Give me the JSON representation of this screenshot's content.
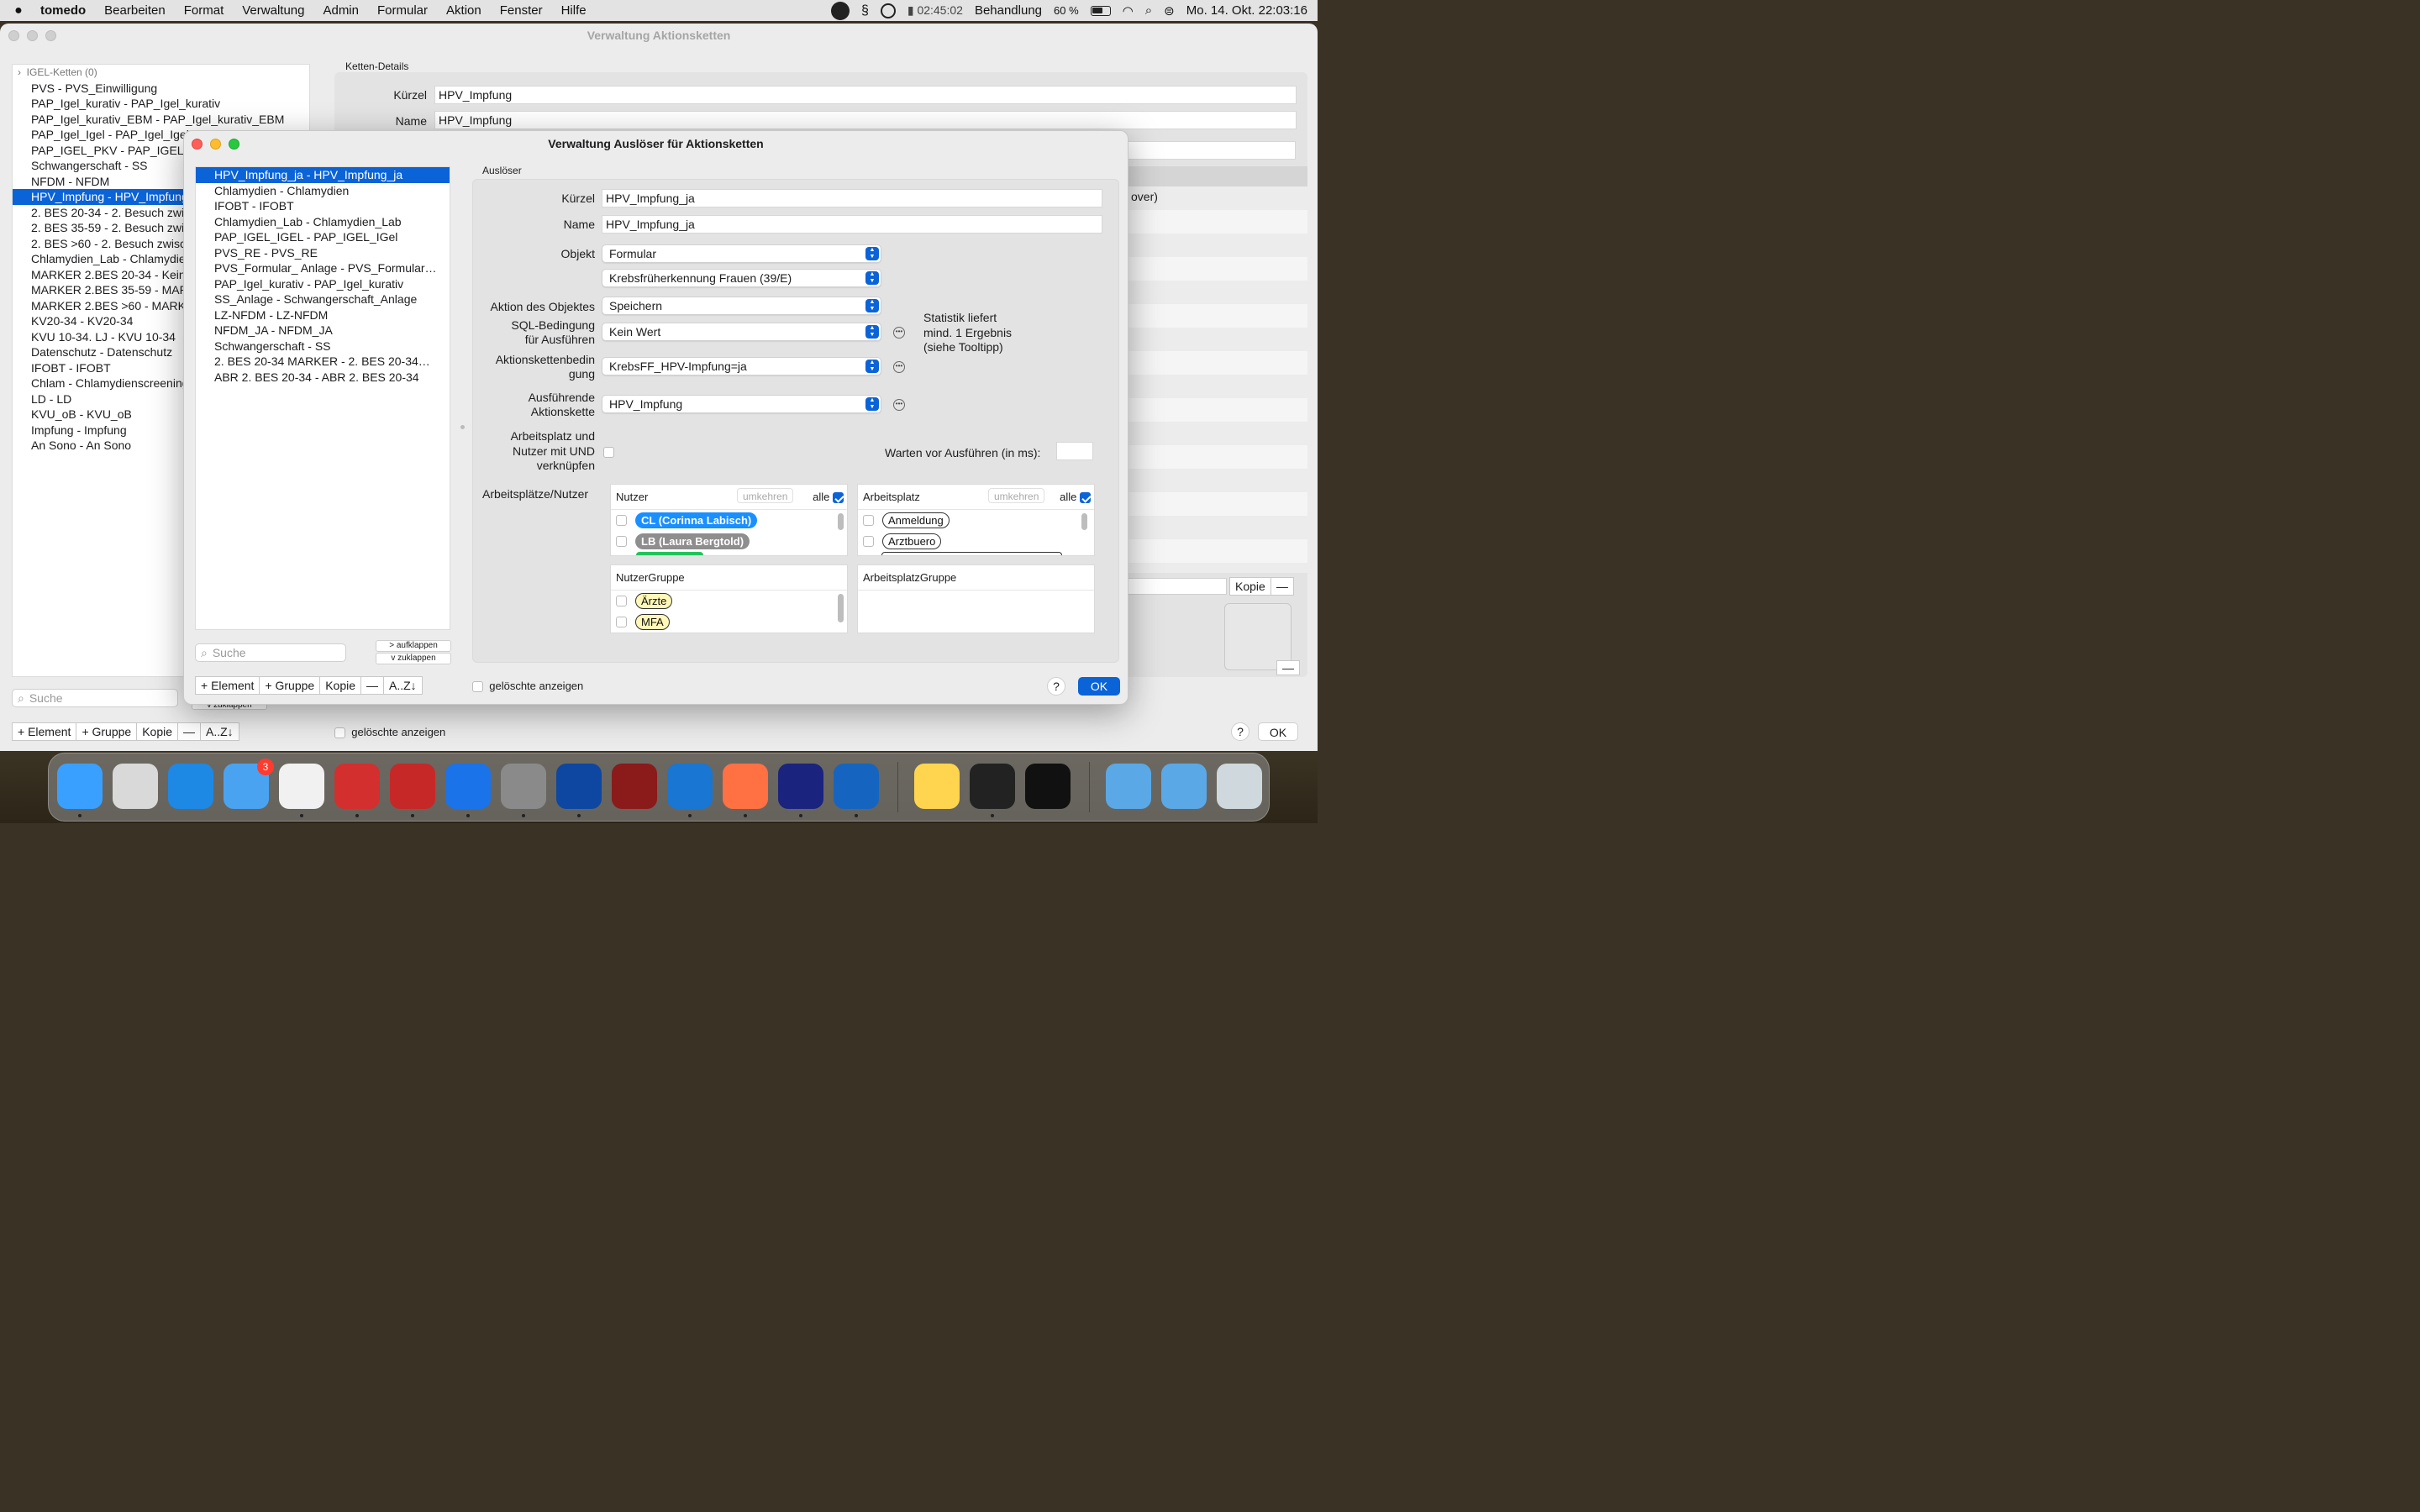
{
  "menubar": {
    "app": "tomedo",
    "items": [
      "Bearbeiten",
      "Format",
      "Verwaltung",
      "Admin",
      "Formular",
      "Aktion",
      "Fenster",
      "Hilfe"
    ],
    "timer": "02:45:02",
    "status": "Behandlung",
    "battery": "60 %",
    "clock": "Mo. 14. Okt. 22:03:16"
  },
  "main_window": {
    "title": "Verwaltung Aktionsketten",
    "list": {
      "group_header": "IGEL-Ketten (0)",
      "items": [
        "PVS - PVS_Einwilligung",
        "PAP_Igel_kurativ - PAP_Igel_kurativ",
        "PAP_Igel_kurativ_EBM - PAP_Igel_kurativ_EBM",
        "PAP_Igel_Igel - PAP_Igel_Igel",
        "PAP_IGEL_PKV - PAP_IGEL_PKV",
        "Schwangerschaft - SS",
        "NFDM - NFDM",
        "HPV_Impfung - HPV_Impfung",
        "2. BES 20-34 - 2. Besuch zwischen 20-34",
        "2. BES 35-59 - 2. Besuch zwischen 35-59",
        "2. BES >60 - 2. Besuch zwischen >60",
        "Chlamydien_Lab - Chlamydien_Lab",
        "MARKER 2.BES 20-34 - Keine",
        "MARKER 2.BES 35-59 - MARKER",
        "MARKER 2.BES >60   - MARKER",
        "KV20-34 - KV20-34",
        "KVU 10-34. LJ - KVU 10-34",
        "Datenschutz - Datenschutz",
        "IFOBT - IFOBT",
        "Chlam - Chlamydienscreening",
        "LD - LD",
        "KVU_oB - KVU_oB",
        "Impfung - Impfung",
        "An Sono - An Sono"
      ],
      "selected_index": 7
    },
    "details_label": "Ketten-Details",
    "kuerzel_label": "Kürzel",
    "kuerzel_value": "HPV_Impfung",
    "name_label": "Name",
    "name_value": "HPV_Impfung",
    "partial_text": "over)",
    "search_placeholder": "Suche",
    "zuklappen": "v  zuklappen",
    "buttons": {
      "element": "+ Element",
      "gruppe": "+ Gruppe",
      "kopie": "Kopie",
      "minus": "—",
      "sort": "A..Z↓"
    },
    "kopie_right": "Kopie",
    "minus_right": "—",
    "geloeschte": "gelöschte anzeigen",
    "help": "?",
    "ok": "OK"
  },
  "modal": {
    "title": "Verwaltung Auslöser für Aktionsketten",
    "list": {
      "items": [
        "HPV_Impfung_ja - HPV_Impfung_ja",
        "Chlamydien - Chlamydien",
        "IFOBT - IFOBT",
        "Chlamydien_Lab - Chlamydien_Lab",
        "PAP_IGEL_IGEL - PAP_IGEL_IGel",
        "PVS_RE - PVS_RE",
        "PVS_Formular_ Anlage - PVS_Formular…",
        "PAP_Igel_kurativ - PAP_Igel_kurativ",
        "SS_Anlage - Schwangerschaft_Anlage",
        "LZ-NFDM - LZ-NFDM",
        "NFDM_JA - NFDM_JA",
        "Schwangerschaft - SS",
        "2. BES 20-34 MARKER - 2. BES 20-34…",
        "ABR 2. BES 20-34 - ABR 2. BES 20-34"
      ],
      "selected_index": 0
    },
    "search_placeholder": "Suche",
    "aufklappen": "> aufklappen",
    "zuklappen": "v  zuklappen",
    "buttons": {
      "element": "+ Element",
      "gruppe": "+ Gruppe",
      "kopie": "Kopie",
      "minus": "—",
      "sort": "A..Z↓"
    },
    "group_label": "Auslöser",
    "kuerzel_label": "Kürzel",
    "kuerzel_value": "HPV_Impfung_ja",
    "name_label": "Name",
    "name_value": "HPV_Impfung_ja",
    "objekt_label": "Objekt",
    "objekt_value": "Formular",
    "formular_value": "Krebsfrüherkennung Frauen (39/E)",
    "aktion_label": "Aktion des Objektes",
    "aktion_value": "Speichern",
    "sql_label_1": "SQL-Bedingung",
    "sql_label_2": "für Ausführen",
    "sql_value": "Kein Wert",
    "statistik_1": "Statistik liefert",
    "statistik_2": "mind. 1 Ergebnis",
    "statistik_3": "(siehe Tooltipp)",
    "kettenbed_label_1": "Aktionskettenbedin",
    "kettenbed_label_2": "gung",
    "kettenbed_value": "KrebsFF_HPV-Impfung=ja",
    "ausf_label_1": "Ausführende",
    "ausf_label_2": "Aktionskette",
    "ausf_value": "HPV_Impfung",
    "und_label_1": "Arbeitsplatz und",
    "und_label_2": "Nutzer mit UND",
    "und_label_3": "verknüpfen",
    "warten_label": "Warten vor Ausführen (in ms):",
    "warten_value": "",
    "arb_label": "Arbeitsplätze/Nutzer",
    "nutzer": {
      "header": "Nutzer",
      "umkehren": "umkehren",
      "alle": "alle",
      "items": [
        "CL (Corinna Labisch)",
        "LB (Laura Bergtold)"
      ]
    },
    "arbeitsplatz": {
      "header": "Arbeitsplatz",
      "umkehren": "umkehren",
      "alle": "alle",
      "items": [
        "Anmeldung",
        "Arztbuero"
      ]
    },
    "nutzergruppe": {
      "header": "NutzerGruppe",
      "items": [
        "Ärzte",
        "MFA"
      ]
    },
    "arbeitsplatzgruppe": {
      "header": "ArbeitsplatzGruppe"
    },
    "geloeschte": "gelöschte anzeigen",
    "help": "?",
    "ok": "OK",
    "colors": {
      "accent": "#0b63d8",
      "pill_blue": "#1a8fff",
      "pill_grey": "#8e8e8e",
      "pill_yellow": "#fff8b8"
    }
  },
  "dock": {
    "mail_badge": "3",
    "icons": [
      "finder-icon",
      "launchpad-icon",
      "safari-icon",
      "mail-icon",
      "preview-icon",
      "tomedo-icon",
      "tomedo-server-icon",
      "appstore-icon",
      "settings-icon",
      "teamviewer-icon",
      "ghidra-icon",
      "tasks-icon",
      "firefox-icon",
      "dash-icon",
      "dna-icon",
      "notes-icon",
      "terminal-icon",
      "console-icon",
      "applications-folder-icon",
      "downloads-folder-icon",
      "trash-icon"
    ]
  }
}
